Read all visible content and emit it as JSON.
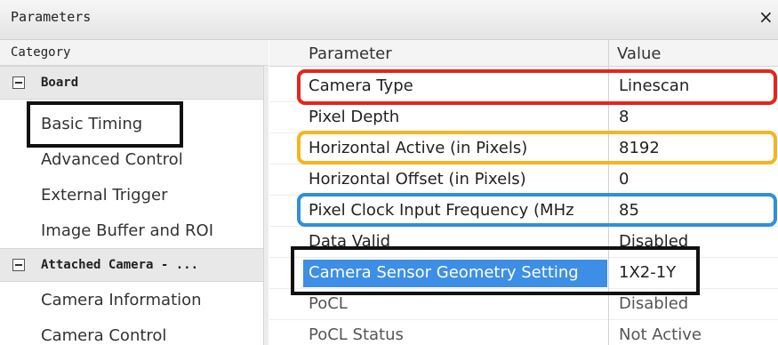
{
  "window": {
    "title": "Parameters",
    "close": "×"
  },
  "category": {
    "header": "Category",
    "groups": [
      {
        "label": "Board",
        "items": [
          "Basic Timing",
          "Advanced Control",
          "External Trigger",
          "Image Buffer and ROI"
        ]
      },
      {
        "label": "Attached Camera - ...",
        "items": [
          "Camera Information",
          "Camera Control"
        ]
      }
    ],
    "selected_item": "Basic Timing"
  },
  "params": {
    "headers": {
      "parameter": "Parameter",
      "value": "Value"
    },
    "rows": [
      {
        "param": "Camera Type",
        "value": "Linescan"
      },
      {
        "param": "Pixel Depth",
        "value": "8"
      },
      {
        "param": "Horizontal Active (in Pixels)",
        "value": "8192"
      },
      {
        "param": "Horizontal Offset (in Pixels)",
        "value": "0"
      },
      {
        "param": "Pixel Clock Input Frequency (MHz",
        "value": "85"
      },
      {
        "param": "Data Valid",
        "value": "Disabled"
      },
      {
        "param": "Camera Sensor Geometry Setting",
        "value": "1X2-1Y"
      },
      {
        "param": "PoCL",
        "value": "Disabled"
      },
      {
        "param": "PoCL Status",
        "value": "Not Active"
      }
    ],
    "selected_row": "Camera Sensor Geometry Setting"
  },
  "colors": {
    "highlight_red": "#e8231d",
    "highlight_yellow": "#f6b41e",
    "highlight_blue": "#2f8fdc",
    "highlight_black": "#111111",
    "selection": "#3d8ee6"
  }
}
